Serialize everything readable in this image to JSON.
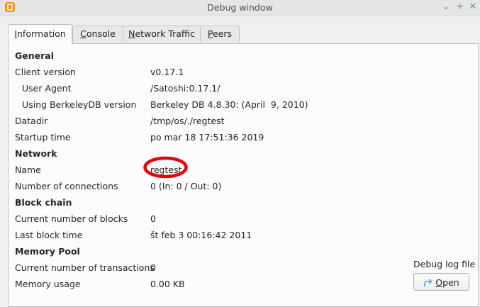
{
  "window": {
    "title": "Debug window"
  },
  "tabs": [
    {
      "pre": "",
      "acc": "I",
      "post": "nformation"
    },
    {
      "pre": "",
      "acc": "C",
      "post": "onsole"
    },
    {
      "pre": "",
      "acc": "N",
      "post": "etwork Traffic"
    },
    {
      "pre": "",
      "acc": "P",
      "post": "eers"
    }
  ],
  "info": {
    "general_heading": "General",
    "client_version_label": "Client version",
    "client_version": "v0.17.1",
    "user_agent_label": "User Agent",
    "user_agent": "/Satoshi:0.17.1/",
    "bdb_label": "Using BerkeleyDB version",
    "bdb_version": "Berkeley DB 4.8.30: (April  9, 2010)",
    "datadir_label": "Datadir",
    "datadir": "/tmp/os/./regtest",
    "startup_label": "Startup time",
    "startup": "po mar 18 17:51:36 2019",
    "network_heading": "Network",
    "name_label": "Name",
    "name": "regtest",
    "connections_label": "Number of connections",
    "connections": "0 (In: 0 / Out: 0)",
    "blockchain_heading": "Block chain",
    "blocks_label": "Current number of blocks",
    "blocks": "0",
    "last_block_label": "Last block time",
    "last_block": "št feb 3 00:16:42 2011",
    "mempool_heading": "Memory Pool",
    "tx_count_label": "Current number of transactions",
    "tx_count": "0",
    "mem_usage_label": "Memory usage",
    "mem_usage": "0.00 KB"
  },
  "debug_log": {
    "label": "Debug log file",
    "open_acc": "O",
    "open_rest": "pen"
  },
  "colors": {
    "highlight": "#e8000b"
  },
  "icons": {
    "open": "arrow-turn-icon",
    "minimize": "chevron-down-icon",
    "maximize": "plus-icon",
    "close": "close-icon"
  }
}
